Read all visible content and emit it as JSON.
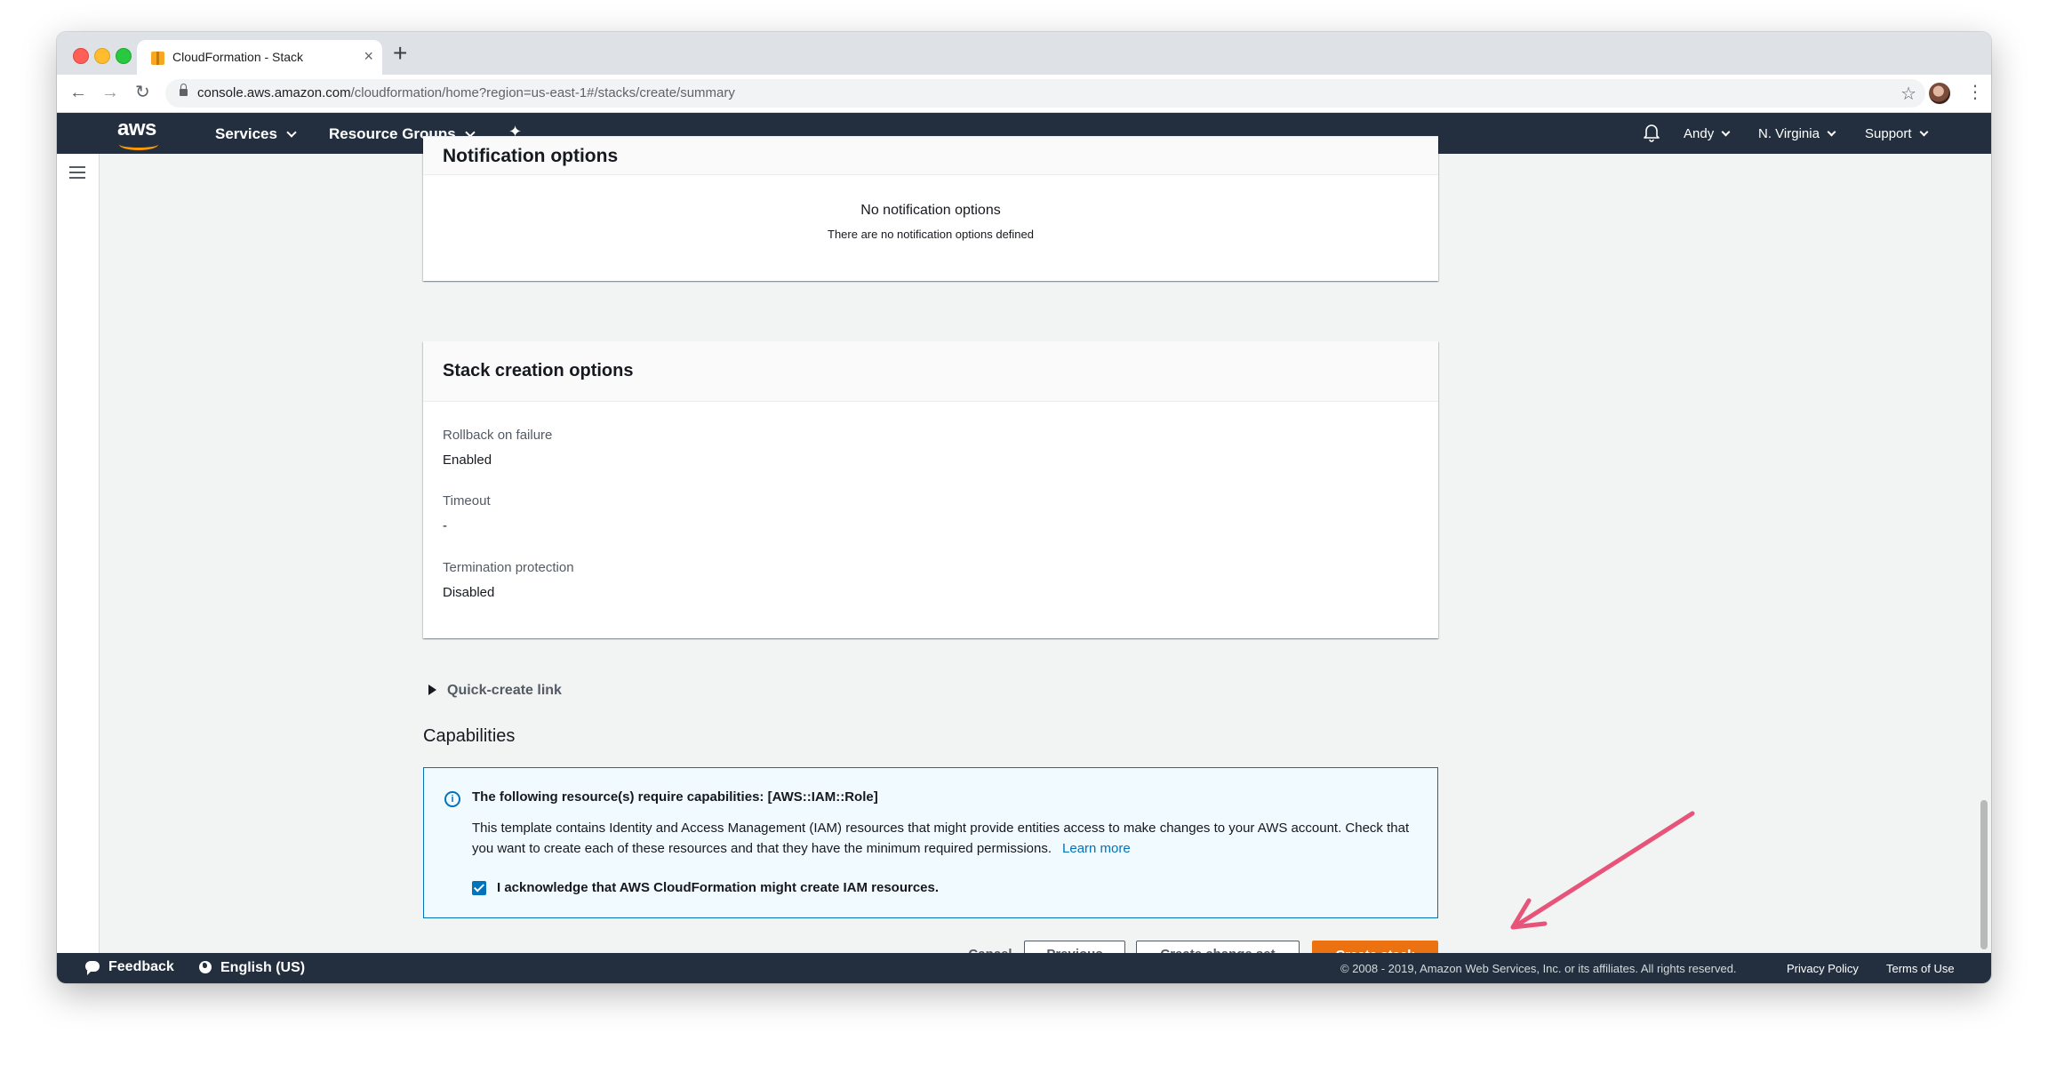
{
  "browser": {
    "tab_title": "CloudFormation - Stack",
    "tab_close": "×",
    "new_tab": "+",
    "url_host": "console.aws.amazon.com",
    "url_path": "/cloudformation/home?region=us-east-1#/stacks/create/summary"
  },
  "aws_nav": {
    "logo": "aws",
    "services": "Services",
    "resource_groups": "Resource Groups",
    "user": "Andy",
    "region": "N. Virginia",
    "support": "Support"
  },
  "notification_panel": {
    "title": "Notification options",
    "empty_title": "No notification options",
    "empty_subtitle": "There are no notification options defined"
  },
  "stack_options": {
    "title": "Stack creation options",
    "items": [
      {
        "label": "Rollback on failure",
        "value": "Enabled"
      },
      {
        "label": "Timeout",
        "value": "-"
      },
      {
        "label": "Termination protection",
        "value": "Disabled"
      }
    ]
  },
  "quick_create": "Quick-create link",
  "capabilities": {
    "heading": "Capabilities",
    "alert_title": "The following resource(s) require capabilities: [AWS::IAM::Role]",
    "alert_body": "This template contains Identity and Access Management (IAM) resources that might provide entities access to make changes to your AWS account. Check that you want to create each of these resources and that they have the minimum required permissions.",
    "learn_more": "Learn more",
    "ack_label": "I acknowledge that AWS CloudFormation might create IAM resources.",
    "ack_checked": true
  },
  "actions": {
    "cancel": "Cancel",
    "previous": "Previous",
    "create_change_set": "Create change set",
    "create_stack": "Create stack"
  },
  "footer": {
    "feedback": "Feedback",
    "language": "English (US)",
    "copyright": "© 2008 - 2019, Amazon Web Services, Inc. or its affiliates. All rights reserved.",
    "privacy": "Privacy Policy",
    "terms": "Terms of Use"
  },
  "colors": {
    "nav_bg": "#232f3e",
    "primary_button": "#ec7211",
    "info_border": "#0073bb",
    "annotation_arrow": "#e8537a"
  }
}
